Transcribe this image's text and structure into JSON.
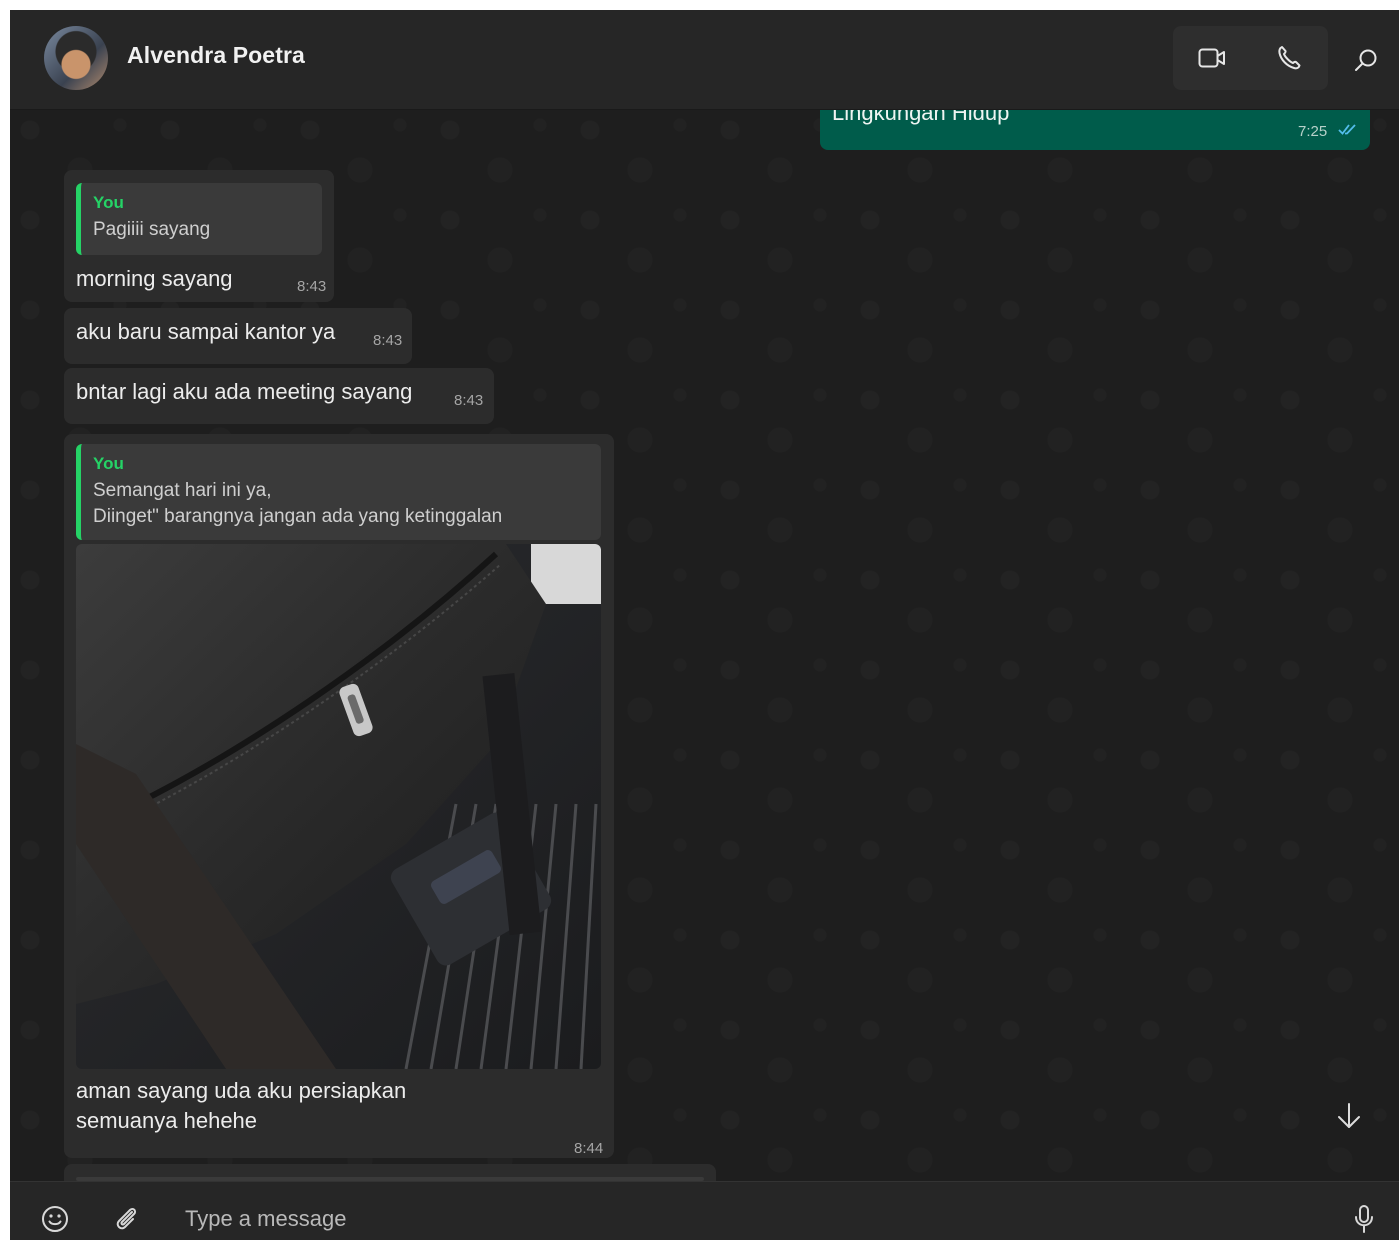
{
  "header": {
    "contact_name": "Alvendra Poetra"
  },
  "messages": {
    "outgoing_top": {
      "text": "Lingkungan Hidup",
      "time": "7:25"
    },
    "m1": {
      "quote_author": "You",
      "quote_text": "Pagiiii sayang",
      "text": "morning sayang",
      "time": "8:43"
    },
    "m2": {
      "text": "aku baru sampai kantor ya",
      "time": "8:43"
    },
    "m3": {
      "text": "bntar lagi aku ada meeting sayang",
      "time": "8:43"
    },
    "m4": {
      "quote_author": "You",
      "quote_line1": "Semangat hari ini ya,",
      "quote_line2": "Diinget\" barangnya jangan ada yang ketinggalan",
      "caption_line1": "aman sayang uda aku persiapkan",
      "caption_line2": "semuanya hehehe",
      "time": "8:44"
    }
  },
  "composer": {
    "placeholder": "Type a message"
  },
  "colors": {
    "outgoing_bubble": "#005c4b",
    "incoming_bubble": "#2c2c2c",
    "quote_accent": "#25d366"
  }
}
